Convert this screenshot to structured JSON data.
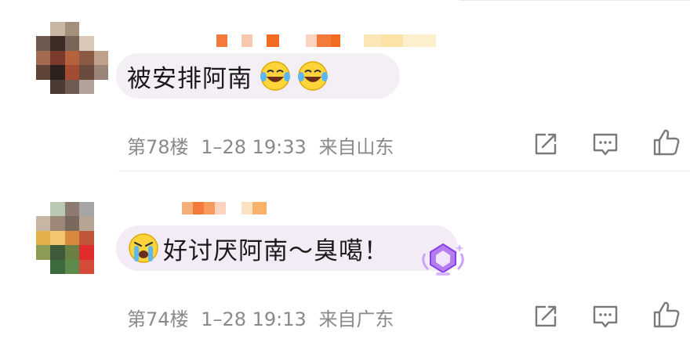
{
  "comments": [
    {
      "text": "被安排阿南",
      "floor": "第78楼",
      "time": "1–28 19:33",
      "location": "来自山东",
      "emojis": [
        "laugh-cry-emoji",
        "laugh-cry-emoji"
      ]
    },
    {
      "text": "好讨厌阿南～臭噶！",
      "floor": "第74楼",
      "time": "1–28 19:13",
      "location": "来自广东",
      "emojis": [
        "crying-emoji"
      ]
    }
  ],
  "icons": {
    "share": "share-icon",
    "comment": "comment-icon",
    "like": "thumbs-up-icon",
    "badge": "purple-gem-badge-icon"
  },
  "colors": {
    "bubble1": "#f4eef5",
    "bubble2": "#f3ecf6",
    "meta_text": "#8a8a8a",
    "accent_orange": "#f26b22",
    "badge_purple": "#a25ee8"
  }
}
